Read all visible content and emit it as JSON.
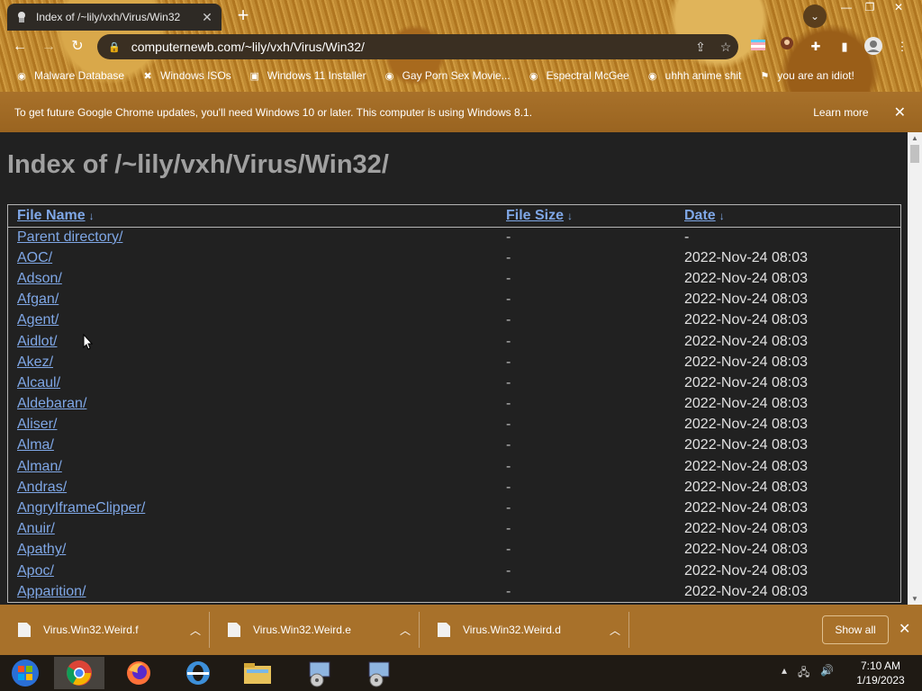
{
  "browser": {
    "tab_title": "Index of /~lily/vxh/Virus/Win32",
    "url": "computernewb.com/~lily/vxh/Virus/Win32/",
    "bookmarks": [
      {
        "label": "Malware Database",
        "icon": "bookmark-icon"
      },
      {
        "label": "Windows ISOs",
        "icon": "x-icon"
      },
      {
        "label": "Windows 11 Installer",
        "icon": "image-icon"
      },
      {
        "label": "Gay Porn Sex Movie...",
        "icon": "site-icon"
      },
      {
        "label": "Espectral McGee",
        "icon": "site-icon"
      },
      {
        "label": "uhhh anime shit",
        "icon": "site-icon"
      },
      {
        "label": "you are an idiot!",
        "icon": "flag-icon"
      }
    ]
  },
  "infobar": {
    "message": "To get future Google Chrome updates, you'll need Windows 10 or later. This computer is using Windows 8.1.",
    "learn_more": "Learn more"
  },
  "page": {
    "heading": "Index of /~lily/vxh/Virus/Win32/",
    "columns": {
      "name": "File Name",
      "size": "File Size",
      "date": "Date",
      "sort_arrow": "↓"
    },
    "rows": [
      {
        "name": "Parent directory/",
        "size": "-",
        "date": "-"
      },
      {
        "name": "AOC/",
        "size": "-",
        "date": "2022-Nov-24 08:03"
      },
      {
        "name": "Adson/",
        "size": "-",
        "date": "2022-Nov-24 08:03"
      },
      {
        "name": "Afgan/",
        "size": "-",
        "date": "2022-Nov-24 08:03"
      },
      {
        "name": "Agent/",
        "size": "-",
        "date": "2022-Nov-24 08:03"
      },
      {
        "name": "Aidlot/",
        "size": "-",
        "date": "2022-Nov-24 08:03"
      },
      {
        "name": "Akez/",
        "size": "-",
        "date": "2022-Nov-24 08:03"
      },
      {
        "name": "Alcaul/",
        "size": "-",
        "date": "2022-Nov-24 08:03"
      },
      {
        "name": "Aldebaran/",
        "size": "-",
        "date": "2022-Nov-24 08:03"
      },
      {
        "name": "Aliser/",
        "size": "-",
        "date": "2022-Nov-24 08:03"
      },
      {
        "name": "Alma/",
        "size": "-",
        "date": "2022-Nov-24 08:03"
      },
      {
        "name": "Alman/",
        "size": "-",
        "date": "2022-Nov-24 08:03"
      },
      {
        "name": "Andras/",
        "size": "-",
        "date": "2022-Nov-24 08:03"
      },
      {
        "name": "AngryIframeClipper/",
        "size": "-",
        "date": "2022-Nov-24 08:03"
      },
      {
        "name": "Anuir/",
        "size": "-",
        "date": "2022-Nov-24 08:03"
      },
      {
        "name": "Apathy/",
        "size": "-",
        "date": "2022-Nov-24 08:03"
      },
      {
        "name": "Apoc/",
        "size": "-",
        "date": "2022-Nov-24 08:03"
      },
      {
        "name": "Apparition/",
        "size": "-",
        "date": "2022-Nov-24 08:03"
      }
    ]
  },
  "downloads": {
    "items": [
      "Virus.Win32.Weird.f",
      "Virus.Win32.Weird.e",
      "Virus.Win32.Weird.d"
    ],
    "show_all": "Show all"
  },
  "taskbar": {
    "time": "7:10 AM",
    "date": "1/19/2023"
  },
  "colors": {
    "link": "#7fa7e6",
    "theme": "#a8712a"
  }
}
